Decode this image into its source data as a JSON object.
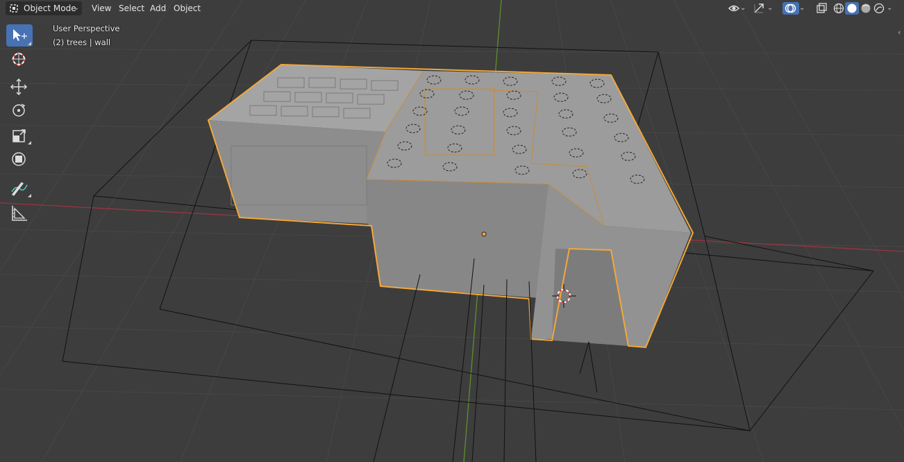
{
  "header": {
    "mode_label": "Object Mode",
    "menus": [
      "View",
      "Select",
      "Add",
      "Object"
    ]
  },
  "overlay": {
    "view_name": "User Perspective",
    "collection_info": "(2) trees | wall"
  },
  "toolbar": {
    "tools": [
      "select-box",
      "cursor",
      "move",
      "rotate",
      "scale",
      "transform",
      "annotate",
      "measure"
    ],
    "active_tool": "select-box"
  },
  "colors": {
    "viewport_bg": "#3d3d3d",
    "selection_outline": "#f4a83a",
    "x_axis": "#b03a4a",
    "y_axis": "#6e9a35",
    "active_tool": "#4772b3"
  }
}
